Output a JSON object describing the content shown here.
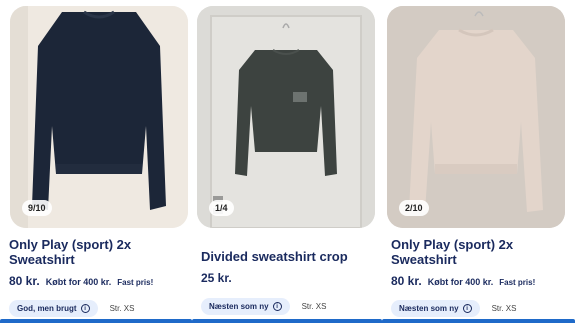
{
  "listings": [
    {
      "image_counter": "9/10",
      "title": "Only Play (sport) 2x Sweatshirt",
      "price": "80 kr.",
      "bought_for": "Købt for 400 kr.",
      "fast_price": "Fast pris!",
      "condition": "God, men brugt",
      "size": "Str. XS"
    },
    {
      "image_counter": "1/4",
      "title": "Divided sweatshirt crop",
      "price": "25 kr.",
      "bought_for": "",
      "fast_price": "",
      "condition": "Næsten som ny",
      "size": "Str. XS"
    },
    {
      "image_counter": "2/10",
      "title": "Only Play (sport) 2x Sweatshirt",
      "price": "80 kr.",
      "bought_for": "Købt for 400 kr.",
      "fast_price": "Fast pris!",
      "condition": "Næsten som ny",
      "size": "Str. XS"
    }
  ],
  "icons": {
    "info": "info-circle-icon"
  },
  "colors": {
    "text_primary": "#1a2a5e",
    "badge_bg": "#e6eefc",
    "accent_bar": "#1f6ac9"
  }
}
